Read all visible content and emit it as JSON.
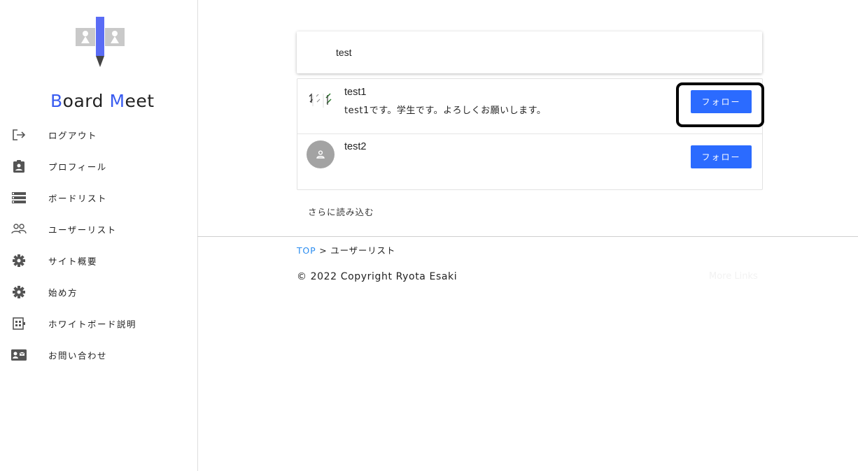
{
  "brand": {
    "first_letter": "B",
    "first_rest": "oard",
    "second_letter": "M",
    "second_rest": "eet"
  },
  "sidebar": {
    "items": [
      {
        "label": "ログアウト",
        "icon": "logout-icon"
      },
      {
        "label": "プロフィール",
        "icon": "profile-badge-icon"
      },
      {
        "label": "ボードリスト",
        "icon": "list-icon"
      },
      {
        "label": "ユーザーリスト",
        "icon": "users-icon"
      },
      {
        "label": "サイト概要",
        "icon": "gear-icon"
      },
      {
        "label": "始め方",
        "icon": "gear-icon"
      },
      {
        "label": "ホワイトボード説明",
        "icon": "whiteboard-icon"
      },
      {
        "label": "お問い合わせ",
        "icon": "contact-card-icon"
      }
    ]
  },
  "search": {
    "value": "test"
  },
  "users": [
    {
      "name": "test1",
      "bio": "test1です。学生です。よろしくお願いします。",
      "follow_label": "フォロー"
    },
    {
      "name": "test2",
      "bio": "",
      "follow_label": "フォロー"
    }
  ],
  "load_more_label": "さらに読み込む",
  "breadcrumb": {
    "top": "TOP",
    "separator": ">",
    "current": "ユーザーリスト"
  },
  "footer": {
    "copyright": "© 2022 Copyright Ryota Esaki",
    "more_links": "More Links"
  },
  "colors": {
    "accent": "#2b6bff",
    "brand_accent": "#3a5cf0",
    "link": "#2a8cf0"
  }
}
